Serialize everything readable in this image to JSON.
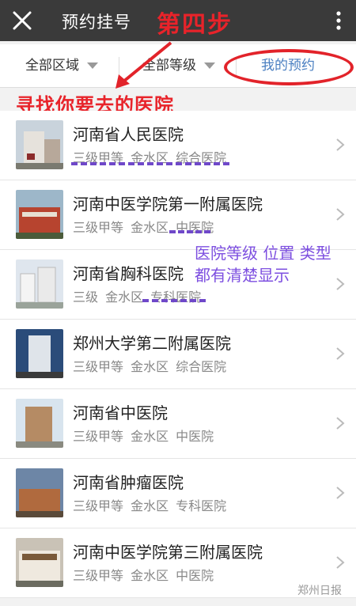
{
  "topbar": {
    "title": "预约挂号",
    "step_label": "第四步"
  },
  "filters": {
    "area": "全部区域",
    "level": "全部等级",
    "mine": "我的预约"
  },
  "annotation": {
    "find": "寻找你要去的医院",
    "note_line1": "医院等级 位置 类型",
    "note_line2": "都有清楚显示"
  },
  "hospitals": [
    {
      "name": "河南省人民医院",
      "meta": "三级甲等 金水区 综合医院"
    },
    {
      "name": "河南中医学院第一附属医院",
      "meta": "三级甲等 金水区 中医院"
    },
    {
      "name": "河南省胸科医院",
      "meta": "三级 金水区 专科医院"
    },
    {
      "name": "郑州大学第二附属医院",
      "meta": "三级甲等 金水区 综合医院"
    },
    {
      "name": "河南省中医院",
      "meta": "三级甲等 金水区 中医院"
    },
    {
      "name": "河南省肿瘤医院",
      "meta": "三级甲等 金水区 专科医院"
    },
    {
      "name": "河南中医学院第三附属医院",
      "meta": "三级甲等 金水区 中医院"
    }
  ],
  "watermark": "郑州日报",
  "colors": {
    "topbar": "#3a3a3a",
    "accent_red": "#e8232a",
    "accent_blue": "#4a7fc1",
    "note_purple": "#7d4fe0"
  },
  "icons": {
    "close": "close-icon",
    "more": "more-vertical-icon",
    "chevron": "chevron-right-icon",
    "caret": "caret-down-icon"
  }
}
